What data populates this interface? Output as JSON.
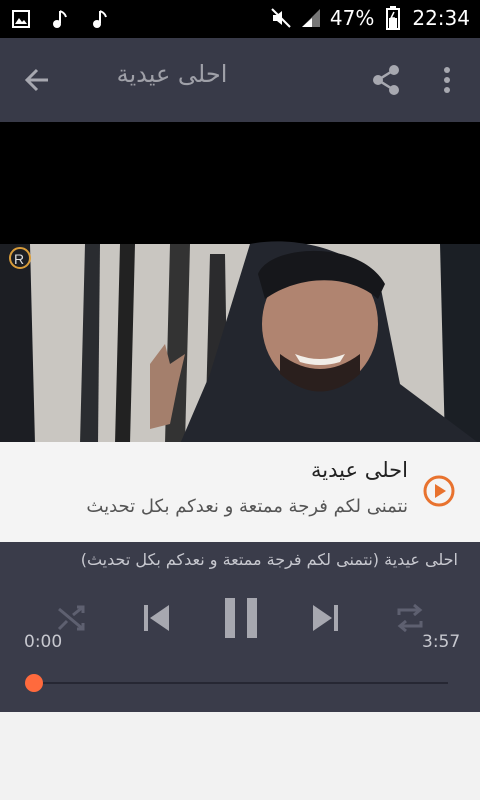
{
  "status_bar": {
    "left_icons": [
      "image-icon",
      "music-note-icon",
      "music-note-icon"
    ],
    "right_icons": [
      "mute-icon",
      "signal-icon",
      "battery-icon"
    ],
    "battery": "47%",
    "time": "22:34"
  },
  "app_bar": {
    "title": "احلى عيدية",
    "icons": [
      "back-arrow-icon",
      "share-icon",
      "more-vert-icon"
    ]
  },
  "video": {
    "watermark": "R"
  },
  "track": {
    "title": "احلى عيدية",
    "subtitle": "نتمنى لكم فرجة ممتعة و نعدكم بكل تحديث",
    "icon": "play-circle-icon"
  },
  "player": {
    "now_playing": "احلى عيدية (نتمنى لكم فرجة ممتعة و نعدكم بكل تحديث)",
    "elapsed": "0:00",
    "duration": "3:57",
    "progress": 0.0,
    "controls": [
      "shuffle-icon",
      "previous-icon",
      "pause-icon",
      "next-icon",
      "repeat-icon"
    ],
    "accent": "#ff6a3d"
  }
}
